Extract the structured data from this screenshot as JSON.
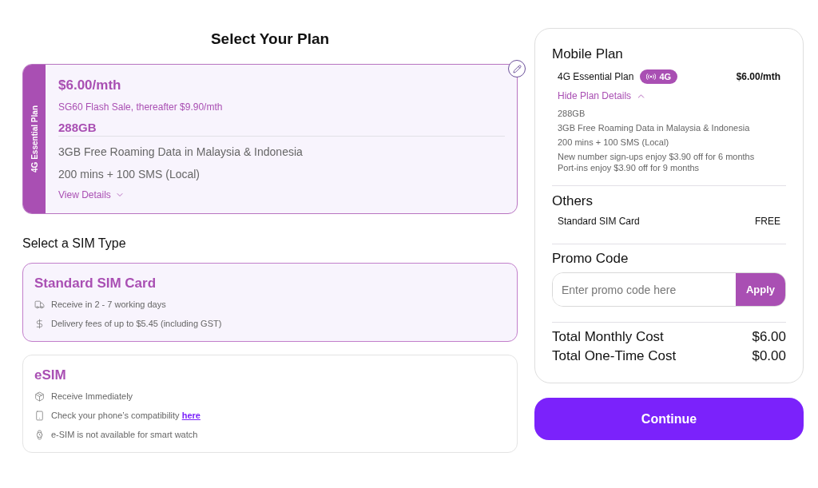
{
  "page_title": "Select Your Plan",
  "plan_card": {
    "side_label": "4G Essential Plan",
    "price": "$6.00/mth",
    "promo": "SG60 Flash Sale, thereafter $9.90/mth",
    "data": "288GB",
    "features": [
      "3GB Free Roaming Data in Malaysia & Indonesia",
      "200 mins + 100 SMS (Local)"
    ],
    "details_link": "View Details",
    "expanded": false
  },
  "sim_section": {
    "title": "Select a SIM Type",
    "options": [
      {
        "name": "Standard SIM Card",
        "selected": true,
        "rows": [
          {
            "text": "Receive in 2 - 7 working days"
          },
          {
            "text": "Delivery fees of up to $5.45 (including GST)"
          }
        ]
      },
      {
        "name": "eSIM",
        "selected": false,
        "rows": [
          {
            "text": "Receive Immediately"
          },
          {
            "text": "Check your phone’s compatibility",
            "link": "here"
          },
          {
            "text": "e-SIM is not available for smart watch"
          }
        ]
      }
    ]
  },
  "summary": {
    "mobile_plan": {
      "title": "Mobile Plan",
      "plan_name": "4G Essential Plan",
      "badge": "4G",
      "price": "$6.00/mth",
      "toggle": "Hide Plan Details",
      "expanded": true,
      "details": [
        "288GB",
        "3GB Free Roaming Data in Malaysia & Indonesia",
        "200 mins + 100 SMS (Local)"
      ],
      "promos": [
        "New number sign-ups enjoy $3.90 off for 6 months",
        "Port-ins enjoy $3.90 off for 9 months"
      ]
    },
    "others": {
      "title": "Others",
      "items": [
        {
          "label": "Standard SIM Card",
          "value": "FREE"
        }
      ]
    },
    "promo_code": {
      "title": "Promo Code",
      "placeholder": "Enter promo code here",
      "button": "Apply"
    },
    "totals": [
      {
        "label": "Total Monthly Cost",
        "value": "$6.00"
      },
      {
        "label": "Total One-Time Cost",
        "value": "$0.00"
      }
    ]
  },
  "continue_button": "Continue"
}
